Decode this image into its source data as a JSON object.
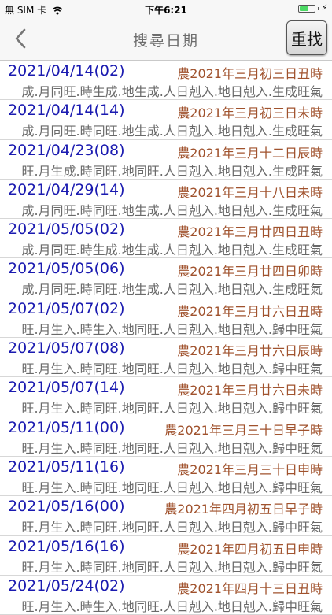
{
  "status": {
    "carrier": "無 SIM 卡",
    "time": "下午6:21",
    "battery_level": 0.6
  },
  "nav": {
    "title": "搜尋日期",
    "refind_label": "重找"
  },
  "results": [
    {
      "date": "2021/04/14(02)",
      "lunar": "農2021年三月初三日丑時",
      "detail": "成.月同旺.時生成.地生成.人日剋入.地日剋入.生成旺氣"
    },
    {
      "date": "2021/04/14(14)",
      "lunar": "農2021年三月初三日未時",
      "detail": "成.月同旺.時同旺.地生成.人日剋入.地日剋入.生成旺氣"
    },
    {
      "date": "2021/04/23(08)",
      "lunar": "農2021年三月十二日辰時",
      "detail": "旺.月生成.時同旺.地同旺.人日剋入.地日剋入.生成旺氣"
    },
    {
      "date": "2021/04/29(14)",
      "lunar": "農2021年三月十八日未時",
      "detail": "成.月同旺.時同旺.地生成.人日剋入.地日剋入.生成旺氣"
    },
    {
      "date": "2021/05/05(02)",
      "lunar": "農2021年三月廿四日丑時",
      "detail": "成.月同旺.時生成.地生成.人日剋入.地日剋入.生成旺氣"
    },
    {
      "date": "2021/05/05(06)",
      "lunar": "農2021年三月廿四日卯時",
      "detail": "成.月同旺.時同旺.地生成.人日剋入.地日剋入.生成旺氣"
    },
    {
      "date": "2021/05/07(02)",
      "lunar": "農2021年三月廿六日丑時",
      "detail": "旺.月生入.時生入.地同旺.人日剋入.地日剋入.歸中旺氣"
    },
    {
      "date": "2021/05/07(08)",
      "lunar": "農2021年三月廿六日辰時",
      "detail": "旺.月生入.時同旺.地同旺.人日剋入.地日剋入.歸中旺氣"
    },
    {
      "date": "2021/05/07(14)",
      "lunar": "農2021年三月廿六日未時",
      "detail": "旺.月生入.時同旺.地同旺.人日剋入.地日剋入.歸中旺氣"
    },
    {
      "date": "2021/05/11(00)",
      "lunar": "農2021年三月三十日早子時",
      "detail": "旺.月生入.時同旺.地同旺.人日剋入.地日剋入.歸中旺氣"
    },
    {
      "date": "2021/05/11(16)",
      "lunar": "農2021年三月三十日申時",
      "detail": "旺.月生入.時同旺.地同旺.人日剋入.地日剋入.歸中旺氣"
    },
    {
      "date": "2021/05/16(00)",
      "lunar": "農2021年四月初五日早子時",
      "detail": "旺.月生入.時同旺.地同旺.人日剋入.地日剋入.歸中旺氣"
    },
    {
      "date": "2021/05/16(16)",
      "lunar": "農2021年四月初五日申時",
      "detail": "旺.月生入.時同旺.地同旺.人日剋入.地日剋入.歸中旺氣"
    },
    {
      "date": "2021/05/24(02)",
      "lunar": "農2021年四月十三日丑時",
      "detail": "旺.月生入.時生入.地同旺.人日剋入.地日剋入.歸中旺氣"
    }
  ]
}
